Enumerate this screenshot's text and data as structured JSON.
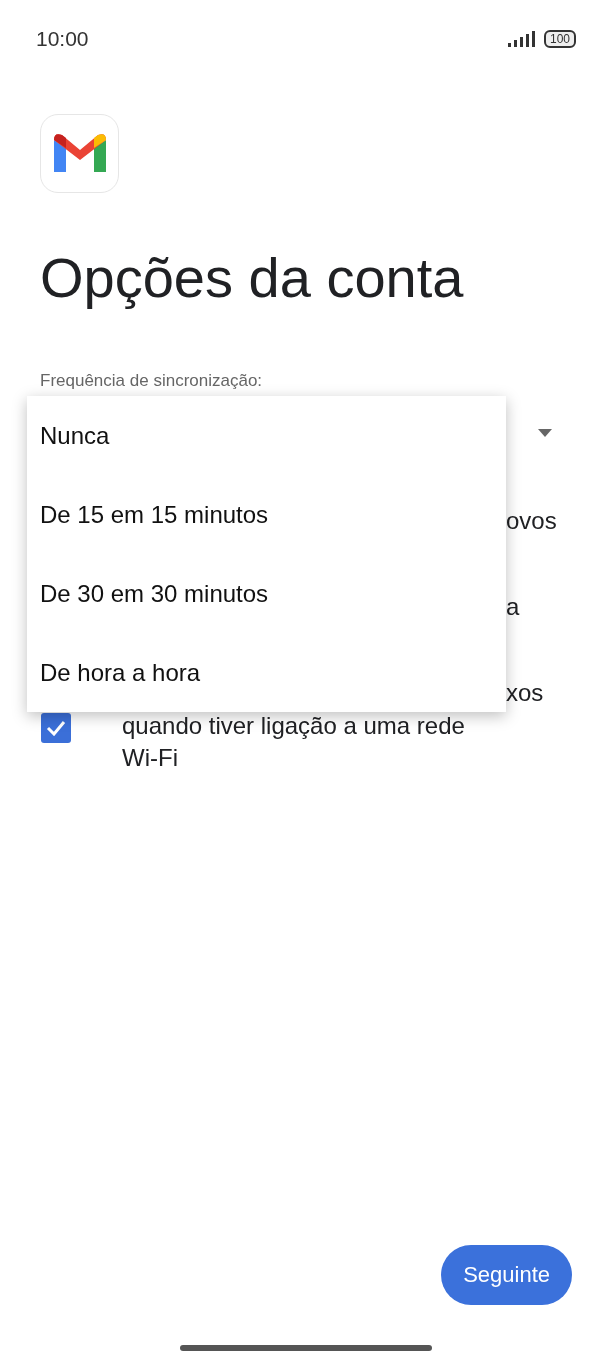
{
  "status_bar": {
    "time": "10:00",
    "battery": "100"
  },
  "title": "Opções da conta",
  "sync_label": "Frequência de sincronização:",
  "hidden_rows": [
    {
      "text": "ovos"
    },
    {
      "text": "a"
    },
    {
      "text": "xos"
    }
  ],
  "wifi_option": {
    "checked": true,
    "text_lines": [
      "quando tiver ligação a uma rede",
      "Wi-Fi"
    ]
  },
  "dropdown_menu": {
    "items": [
      {
        "label": "Nunca"
      },
      {
        "label": "De 15 em 15 minutos"
      },
      {
        "label": "De 30 em 30 minutos"
      },
      {
        "label": "De hora a hora"
      }
    ]
  },
  "next_button": "Seguinte"
}
